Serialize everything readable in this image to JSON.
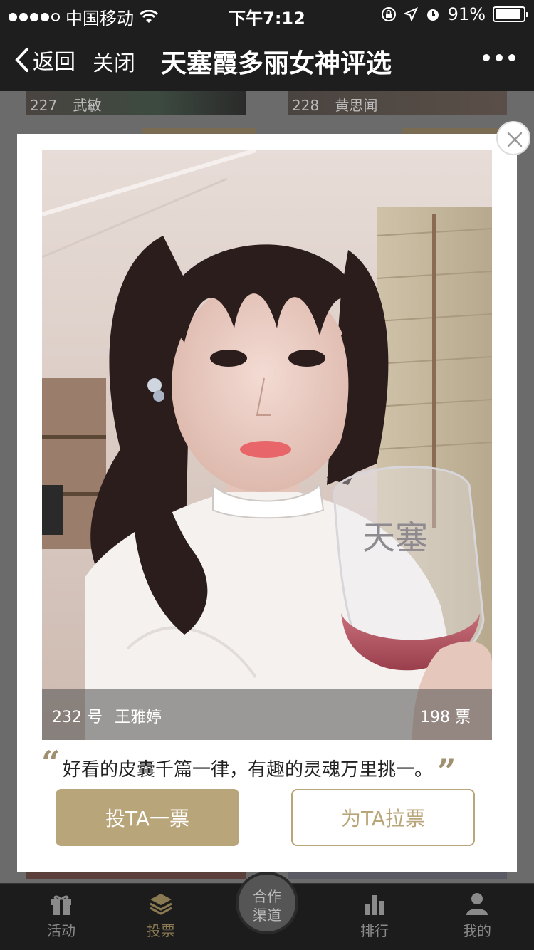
{
  "status_bar": {
    "carrier": "中国移动",
    "time": "下午7:12",
    "battery": "91%",
    "battery_level": 0.91
  },
  "nav": {
    "back_label": "返回",
    "close_label": "关闭",
    "title": "天塞霞多丽女神评选"
  },
  "background_cards": [
    {
      "number": "227",
      "name": "武敏"
    },
    {
      "number": "228",
      "name": "黄思闻"
    }
  ],
  "modal": {
    "contestant_number": "232 号",
    "contestant_name": "王雅婷",
    "votes": "198 票",
    "quote_open": "“",
    "quote_text": "好看的皮囊千篇一律，有趣的灵魂万里挑一。",
    "quote_close": "”",
    "vote_button": "投TA一票",
    "canvass_button": "为TA拉票",
    "photo_glass_text": "天塞"
  },
  "tab_bar": {
    "items": [
      {
        "label": "活动",
        "icon": "gift-icon"
      },
      {
        "label": "投票",
        "icon": "layers-icon",
        "active": true
      },
      {
        "label": "排行",
        "icon": "bar-chart-icon"
      },
      {
        "label": "我的",
        "icon": "user-icon"
      }
    ],
    "center_line1": "合作",
    "center_line2": "渠道"
  },
  "colors": {
    "accent": "#b9a57a",
    "bar_bg": "#1e1e1e"
  }
}
